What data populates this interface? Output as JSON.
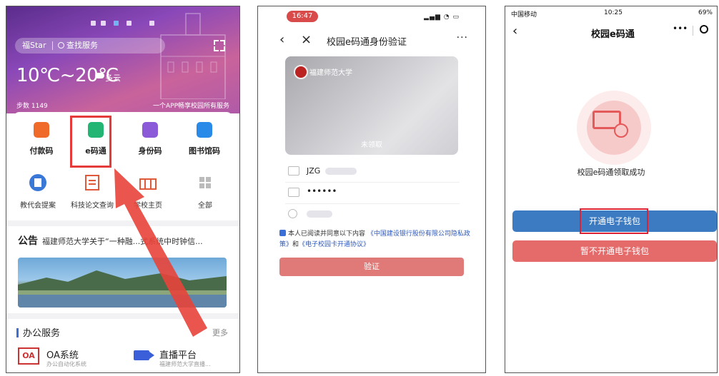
{
  "phone1": {
    "status_time": "",
    "brand": "福Star",
    "search_placeholder": "查找服务",
    "temperature": "10℃~20℃",
    "weather": "多云",
    "steps": "步数 1149",
    "slogan": "一个APP畅享校园所有服务",
    "services": [
      {
        "label": "付款码",
        "color": "#f06a2a"
      },
      {
        "label": "e码通",
        "color": "#22b573"
      },
      {
        "label": "身份码",
        "color": "#8a5ad8"
      },
      {
        "label": "图书馆码",
        "color": "#2a8ae8"
      }
    ],
    "row2": [
      {
        "label": "教代会提案"
      },
      {
        "label": "科技论文查询"
      },
      {
        "label": "学校主页"
      },
      {
        "label": "全部"
      }
    ],
    "notice_title": "公告",
    "notice_text": "福建师范大学关于“一种融...式系统中时钟信...",
    "office_title": "办公服务",
    "office_more": "更多",
    "oa_icon": "OA",
    "oa_title": "OA系统",
    "oa_sub": "办公自动化系统",
    "live_title": "直播平台",
    "live_sub": "福建师范大学直播..."
  },
  "phone2": {
    "status_time": "16:47",
    "title": "校园e码通身份验证",
    "menu": "···",
    "card_name": "福建师范大学",
    "card_status": "未领取",
    "field1": "JZG",
    "field2": "••••••",
    "agree_prefix": "本人已阅读并同意以下内容",
    "agree_link1": "《中国建设银行股份有限公司隐私政策》",
    "agree_mid": "和",
    "agree_link2": "《电子校园卡开通协议》",
    "verify_button": "验证"
  },
  "phone3": {
    "carrier": "中国移动",
    "time": "10:25",
    "battery": "69%",
    "title": "校园e码通",
    "success_text": "校园e码通领取成功",
    "open_button": "开通电子钱包",
    "skip_button": "暂不开通电子钱包"
  },
  "colors": {
    "highlight": "#e43a3a",
    "primary_blue": "#3c7ac2",
    "danger_red": "#e56b6b"
  }
}
